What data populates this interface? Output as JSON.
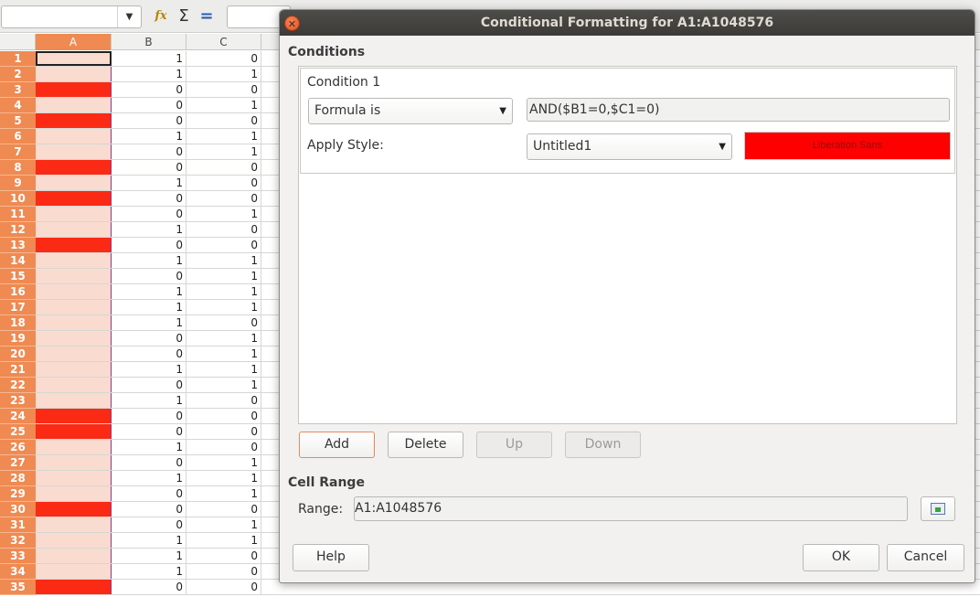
{
  "namebox": {
    "value": ""
  },
  "toolbar": {
    "fx_icon": "fx-icon",
    "sum_icon": "sum-icon",
    "equals_icon": "equals-icon"
  },
  "formula_bar": {
    "value": ""
  },
  "columns": [
    "A",
    "B",
    "C"
  ],
  "rows": [
    {
      "n": "1",
      "b": "1",
      "c": "0",
      "hit": false
    },
    {
      "n": "2",
      "b": "1",
      "c": "1",
      "hit": false
    },
    {
      "n": "3",
      "b": "0",
      "c": "0",
      "hit": true
    },
    {
      "n": "4",
      "b": "0",
      "c": "1",
      "hit": false
    },
    {
      "n": "5",
      "b": "0",
      "c": "0",
      "hit": true
    },
    {
      "n": "6",
      "b": "1",
      "c": "1",
      "hit": false
    },
    {
      "n": "7",
      "b": "0",
      "c": "1",
      "hit": false
    },
    {
      "n": "8",
      "b": "0",
      "c": "0",
      "hit": true
    },
    {
      "n": "9",
      "b": "1",
      "c": "0",
      "hit": false
    },
    {
      "n": "10",
      "b": "0",
      "c": "0",
      "hit": true
    },
    {
      "n": "11",
      "b": "0",
      "c": "1",
      "hit": false
    },
    {
      "n": "12",
      "b": "1",
      "c": "0",
      "hit": false
    },
    {
      "n": "13",
      "b": "0",
      "c": "0",
      "hit": true
    },
    {
      "n": "14",
      "b": "1",
      "c": "1",
      "hit": false
    },
    {
      "n": "15",
      "b": "0",
      "c": "1",
      "hit": false
    },
    {
      "n": "16",
      "b": "1",
      "c": "1",
      "hit": false
    },
    {
      "n": "17",
      "b": "1",
      "c": "1",
      "hit": false
    },
    {
      "n": "18",
      "b": "1",
      "c": "0",
      "hit": false
    },
    {
      "n": "19",
      "b": "0",
      "c": "1",
      "hit": false
    },
    {
      "n": "20",
      "b": "0",
      "c": "1",
      "hit": false
    },
    {
      "n": "21",
      "b": "1",
      "c": "1",
      "hit": false
    },
    {
      "n": "22",
      "b": "0",
      "c": "1",
      "hit": false
    },
    {
      "n": "23",
      "b": "1",
      "c": "0",
      "hit": false
    },
    {
      "n": "24",
      "b": "0",
      "c": "0",
      "hit": true
    },
    {
      "n": "25",
      "b": "0",
      "c": "0",
      "hit": true
    },
    {
      "n": "26",
      "b": "1",
      "c": "0",
      "hit": false
    },
    {
      "n": "27",
      "b": "0",
      "c": "1",
      "hit": false
    },
    {
      "n": "28",
      "b": "1",
      "c": "1",
      "hit": false
    },
    {
      "n": "29",
      "b": "0",
      "c": "1",
      "hit": false
    },
    {
      "n": "30",
      "b": "0",
      "c": "0",
      "hit": true
    },
    {
      "n": "31",
      "b": "0",
      "c": "1",
      "hit": false
    },
    {
      "n": "32",
      "b": "1",
      "c": "1",
      "hit": false
    },
    {
      "n": "33",
      "b": "1",
      "c": "0",
      "hit": false
    },
    {
      "n": "34",
      "b": "1",
      "c": "0",
      "hit": false
    },
    {
      "n": "35",
      "b": "0",
      "c": "0",
      "hit": true
    }
  ],
  "colors": {
    "row_header": "#f08a53",
    "cell_light": "#fadbd0",
    "cell_hit": "#fa2a14",
    "preview_bg": "#fe0000"
  },
  "dialog": {
    "title": "Conditional Formatting for A1:A1048576",
    "conditions_label": "Conditions",
    "condition_title": "Condition 1",
    "type_value": "Formula is",
    "formula_value": "AND($B1=0,$C1=0)",
    "apply_style_label": "Apply Style:",
    "style_value": "Untitled1",
    "preview_text": "Liberation Sans",
    "add_label": "Add",
    "delete_label": "Delete",
    "up_label": "Up",
    "down_label": "Down",
    "cell_range_label": "Cell Range",
    "range_label": "Range:",
    "range_value": "A1:A1048576",
    "help_label": "Help",
    "ok_label": "OK",
    "cancel_label": "Cancel"
  }
}
